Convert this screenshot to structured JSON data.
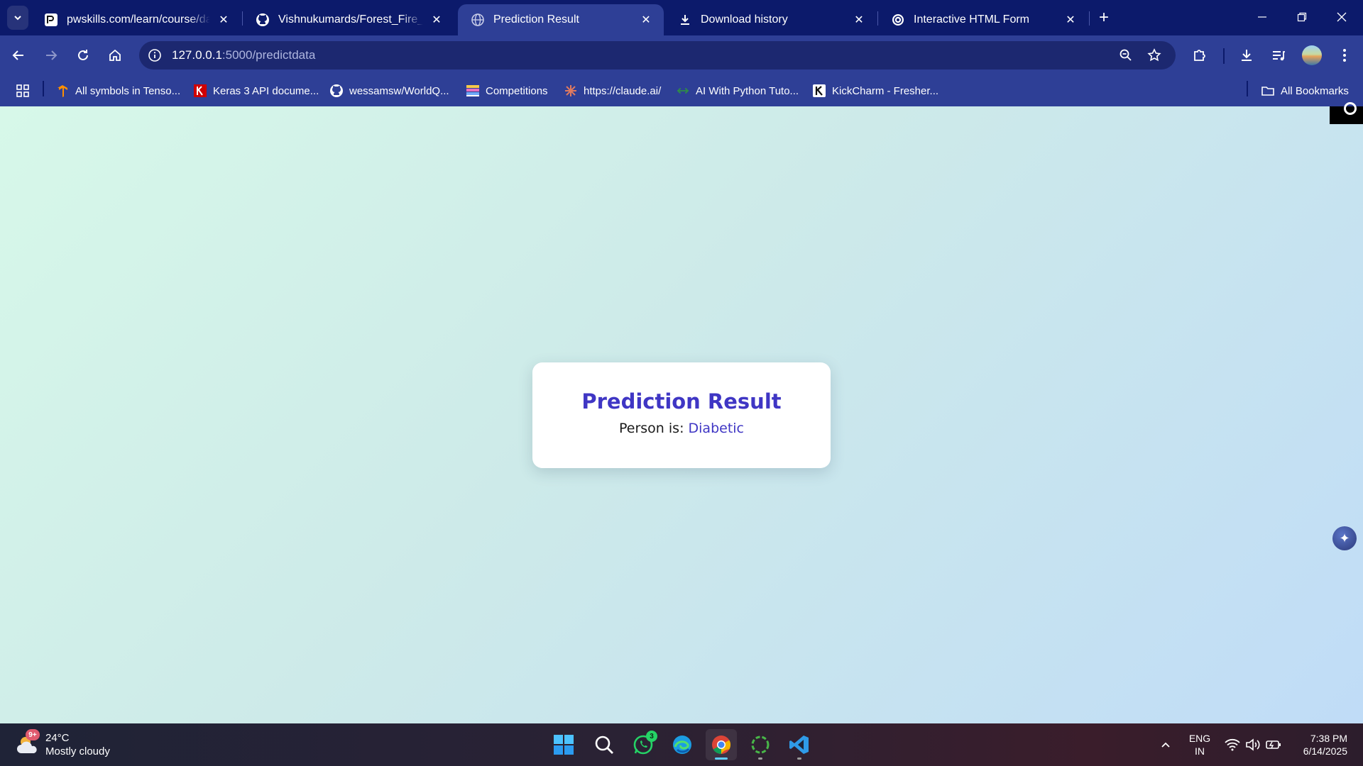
{
  "browser": {
    "tabs": [
      {
        "title": "pwskills.com/learn/course/data",
        "favicon": "pwskills-icon",
        "active": false
      },
      {
        "title": "Vishnukumards/Forest_Fire_Ana",
        "favicon": "github-icon",
        "active": false
      },
      {
        "title": "Prediction Result",
        "favicon": "globe-icon",
        "active": true
      },
      {
        "title": "Download history",
        "favicon": "download-icon",
        "active": false
      },
      {
        "title": "Interactive HTML Form",
        "favicon": "openai-icon",
        "active": false
      }
    ],
    "url_host": "127.0.0.1",
    "url_path": ":5000/predictdata",
    "bookmarks": [
      {
        "label": "All symbols in Tenso...",
        "icon": "tensorflow-icon"
      },
      {
        "label": "Keras 3 API docume...",
        "icon": "keras-icon"
      },
      {
        "label": "wessamsw/WorldQ...",
        "icon": "github-icon"
      },
      {
        "label": "Competitions",
        "icon": "competitions-icon"
      },
      {
        "label": "https://claude.ai/",
        "icon": "claude-icon"
      },
      {
        "label": "AI With Python Tuto...",
        "icon": "geeksforgeeks-icon"
      },
      {
        "label": "KickCharm - Fresher...",
        "icon": "kickcharm-icon"
      }
    ],
    "all_bookmarks_label": "All Bookmarks"
  },
  "page": {
    "title": "Prediction Result",
    "result_prefix": "Person is:",
    "result_value": "Diabetic",
    "accent_color": "#3f36c4"
  },
  "taskbar": {
    "weather_temp": "24°C",
    "weather_desc": "Mostly cloudy",
    "weather_badge": "9+",
    "whatsapp_badge": "3",
    "lang_line1": "ENG",
    "lang_line2": "IN",
    "time": "7:38 PM",
    "date": "6/14/2025"
  }
}
